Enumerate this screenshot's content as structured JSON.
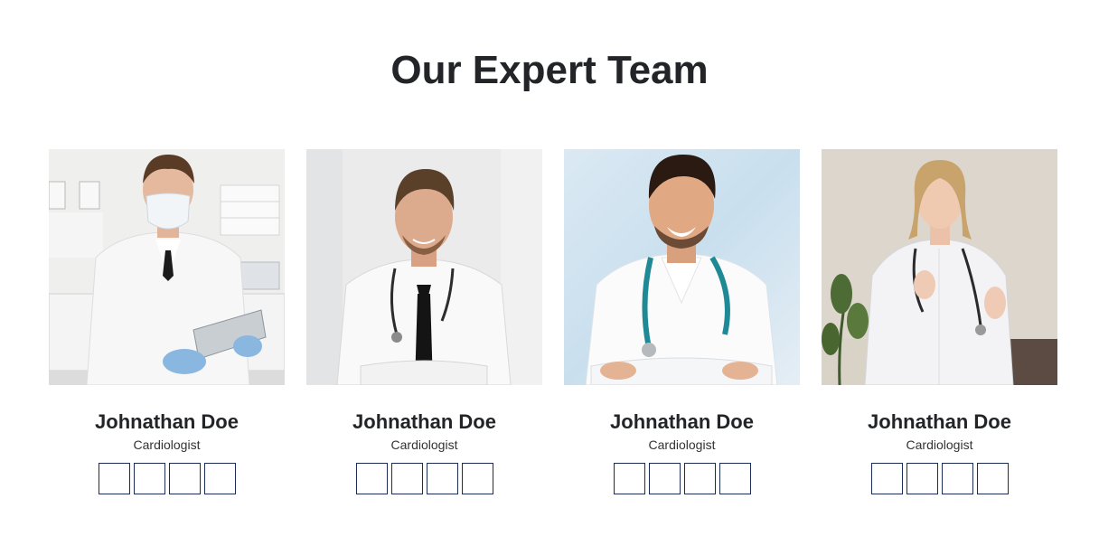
{
  "section": {
    "title": "Our Expert Team"
  },
  "team": [
    {
      "name": "Johnathan Doe",
      "role": "Cardiologist",
      "photo_alt": "doctor-photo",
      "social_links": [
        "social-link-1",
        "social-link-2",
        "social-link-3",
        "social-link-4"
      ]
    },
    {
      "name": "Johnathan Doe",
      "role": "Cardiologist",
      "photo_alt": "doctor-photo",
      "social_links": [
        "social-link-1",
        "social-link-2",
        "social-link-3",
        "social-link-4"
      ]
    },
    {
      "name": "Johnathan Doe",
      "role": "Cardiologist",
      "photo_alt": "doctor-photo",
      "social_links": [
        "social-link-1",
        "social-link-2",
        "social-link-3",
        "social-link-4"
      ]
    },
    {
      "name": "Johnathan Doe",
      "role": "Cardiologist",
      "photo_alt": "doctor-photo",
      "social_links": [
        "social-link-1",
        "social-link-2",
        "social-link-3",
        "social-link-4"
      ]
    }
  ],
  "colors": {
    "heading": "#222428",
    "social_border": "#1c2d55",
    "background": "#ffffff"
  }
}
